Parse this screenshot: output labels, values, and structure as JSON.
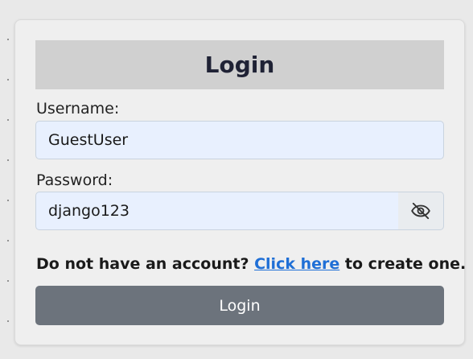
{
  "form": {
    "title": "Login",
    "username_label": "Username:",
    "username_value": "GuestUser",
    "password_label": "Password:",
    "password_value": "django123",
    "toggle_icon": "eye-slash-icon",
    "signup_prefix": "Do not have an account? ",
    "signup_link": "Click here",
    "signup_suffix": " to create one.",
    "submit_label": "Login"
  },
  "colors": {
    "header_bg": "#d0d0d0",
    "input_bg": "#e8f0fe",
    "link": "#1f6fd6",
    "button_bg": "#6c737c"
  }
}
